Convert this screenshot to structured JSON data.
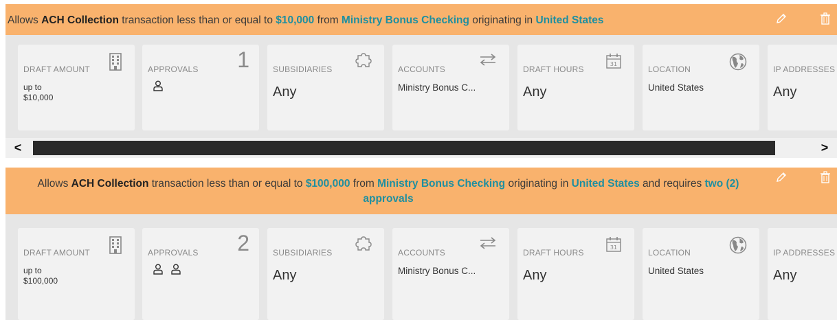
{
  "rules": [
    {
      "parts": {
        "allows": "Allows",
        "type": "ACH Collection",
        "mid1": "transaction less than or equal to",
        "amount": "$10,000",
        "from": "from",
        "account": "Ministry Bonus Checking",
        "orig": "originating in",
        "location": "United States"
      },
      "cards": {
        "draft_amount": {
          "title": "DRAFT AMOUNT",
          "line1": "up to",
          "line2": "$10,000"
        },
        "approvals": {
          "title": "APPROVALS",
          "count": "1"
        },
        "subsidiaries": {
          "title": "SUBSIDIARIES",
          "value": "Any"
        },
        "accounts": {
          "title": "ACCOUNTS",
          "value": "Ministry Bonus C..."
        },
        "draft_hours": {
          "title": "DRAFT HOURS",
          "value": "Any",
          "calendar_day": "31"
        },
        "location": {
          "title": "LOCATION",
          "value": "United States"
        },
        "ip_addresses": {
          "title": "IP ADDRESSES",
          "value": "Any"
        }
      }
    },
    {
      "parts": {
        "allows": "Allows",
        "type": "ACH Collection",
        "mid1": "transaction less than or equal to",
        "amount": "$100,000",
        "from": "from",
        "account": "Ministry Bonus Checking",
        "orig": "originating in",
        "location": "United States",
        "requires": "and requires",
        "approvals": "two (2) approvals"
      },
      "cards": {
        "draft_amount": {
          "title": "DRAFT AMOUNT",
          "line1": "up to",
          "line2": "$100,000"
        },
        "approvals": {
          "title": "APPROVALS",
          "count": "2"
        },
        "subsidiaries": {
          "title": "SUBSIDIARIES",
          "value": "Any"
        },
        "accounts": {
          "title": "ACCOUNTS",
          "value": "Ministry Bonus C..."
        },
        "draft_hours": {
          "title": "DRAFT HOURS",
          "value": "Any",
          "calendar_day": "31"
        },
        "location": {
          "title": "LOCATION",
          "value": "United States"
        },
        "ip_addresses": {
          "title": "IP ADDRESSES",
          "value": "Any"
        }
      }
    }
  ],
  "scrollbar": {
    "left_arrow": "<",
    "right_arrow": ">"
  },
  "colors": {
    "header_bg": "#f9b26d",
    "highlight": "#1f8fa0",
    "cards_bg": "#e6e6e6",
    "card_bg": "#f2f2f2"
  },
  "icons": [
    "pencil-icon",
    "trash-icon",
    "building-icon",
    "user-icon",
    "puzzle-icon",
    "swap-arrows-icon",
    "calendar-icon",
    "globe-icon"
  ]
}
